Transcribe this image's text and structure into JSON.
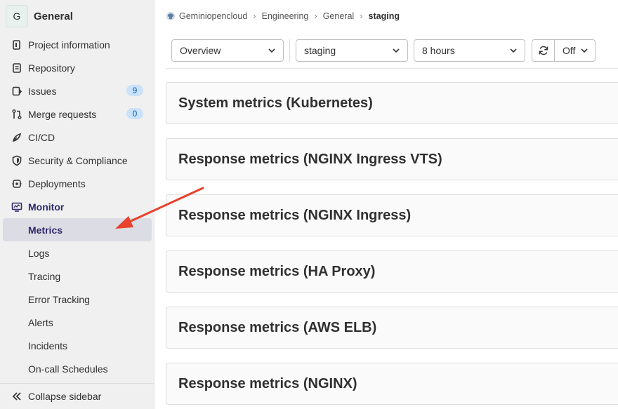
{
  "project": {
    "avatar_letter": "G",
    "name": "General"
  },
  "sidebar": {
    "items": [
      {
        "label": "Project information",
        "icon": "project-info-icon"
      },
      {
        "label": "Repository",
        "icon": "repository-icon"
      },
      {
        "label": "Issues",
        "icon": "issues-icon",
        "badge": "9"
      },
      {
        "label": "Merge requests",
        "icon": "merge-request-icon",
        "badge": "0"
      },
      {
        "label": "CI/CD",
        "icon": "rocket-icon"
      },
      {
        "label": "Security & Compliance",
        "icon": "shield-icon"
      },
      {
        "label": "Deployments",
        "icon": "deployments-icon"
      },
      {
        "label": "Monitor",
        "icon": "monitor-icon"
      }
    ],
    "monitor_sub": [
      "Metrics",
      "Logs",
      "Tracing",
      "Error Tracking",
      "Alerts",
      "Incidents",
      "On-call Schedules"
    ],
    "active_sub": "Metrics",
    "collapse_label": "Collapse sidebar"
  },
  "breadcrumb": {
    "items": [
      "Geminiopencloud",
      "Engineering",
      "General"
    ],
    "current": "staging"
  },
  "filters": {
    "dashboard": "Overview",
    "environment": "staging",
    "time_range": "8 hours",
    "refresh_rate": "Off"
  },
  "panels": [
    "System metrics (Kubernetes)",
    "Response metrics (NGINX Ingress VTS)",
    "Response metrics (NGINX Ingress)",
    "Response metrics (HA Proxy)",
    "Response metrics (AWS ELB)",
    "Response metrics (NGINX)"
  ],
  "colors": {
    "accent": "#2f2a6b",
    "annotation_arrow": "#e8412c",
    "badge_bg": "#cbe2f9"
  }
}
